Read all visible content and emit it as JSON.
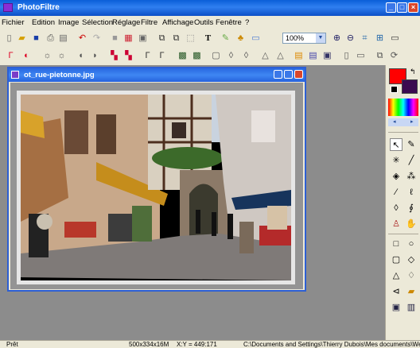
{
  "app": {
    "title": "PhotoFiltre"
  },
  "menu": [
    "Fichier",
    "Edition",
    "Image",
    "Sélection",
    "Réglage",
    "Filtre",
    "Affichage",
    "Outils",
    "Fenêtre",
    "?"
  ],
  "toolbar1": {
    "icons": [
      "new-icon",
      "open-icon",
      "save-icon",
      "print-icon",
      "scan-icon",
      "undo-icon",
      "redo-icon",
      "stop-icon",
      "color-icon",
      "gray-icon",
      "copy-image-icon",
      "paste-image-icon",
      "selection-icon",
      "text-icon",
      "effects-icon",
      "hand-paint-icon",
      "fit-icon",
      "zoom-in-icon",
      "zoom-out-icon",
      "fit-window-icon",
      "full-screen-icon",
      "monitor-icon"
    ],
    "zoom_value": "100%"
  },
  "toolbar2": {
    "icons": [
      "auto-levels-icon",
      "auto-contrast-icon",
      "brightness-down-icon",
      "brightness-up-icon",
      "contrast-down-icon",
      "contrast-up-icon",
      "saturation-down-icon",
      "saturation-up-icon",
      "gamma-down-icon",
      "gamma-up-icon",
      "blur-icon",
      "sharpen-icon",
      "dust-icon",
      "drop-icon",
      "drop2-icon",
      "triangle-icon",
      "triangle2-icon",
      "image-frame-icon",
      "image-frame2-icon",
      "canvas-icon",
      "book-icon",
      "doc-icon",
      "resize-icon",
      "rotate-icon"
    ]
  },
  "document": {
    "title": "ot_rue-pietonne.jpg"
  },
  "palette": {
    "front_color": "#ff0000",
    "back_color": "#3a0a50",
    "tools": [
      "pointer-icon",
      "eyedropper-icon",
      "magic-wand-icon",
      "line-icon",
      "fill-icon",
      "spray-icon",
      "brush-icon",
      "advanced-brush-icon",
      "blur-drop-icon",
      "smudge-icon",
      "stamp-icon",
      "hand-icon"
    ],
    "shapes": [
      "rectangle-icon",
      "ellipse-icon",
      "rounded-rect-icon",
      "diamond-icon",
      "triangle-shape-icon",
      "lasso-icon",
      "polygon-icon",
      "import-icon",
      "select-all-icon",
      "invert-icon"
    ]
  },
  "status": {
    "state": "Prêt",
    "size": "500x334x16M",
    "coords": "X:Y = 449:171",
    "path": "C:\\Documents and Settings\\Thierry Dubois\\Mes documents\\We"
  }
}
